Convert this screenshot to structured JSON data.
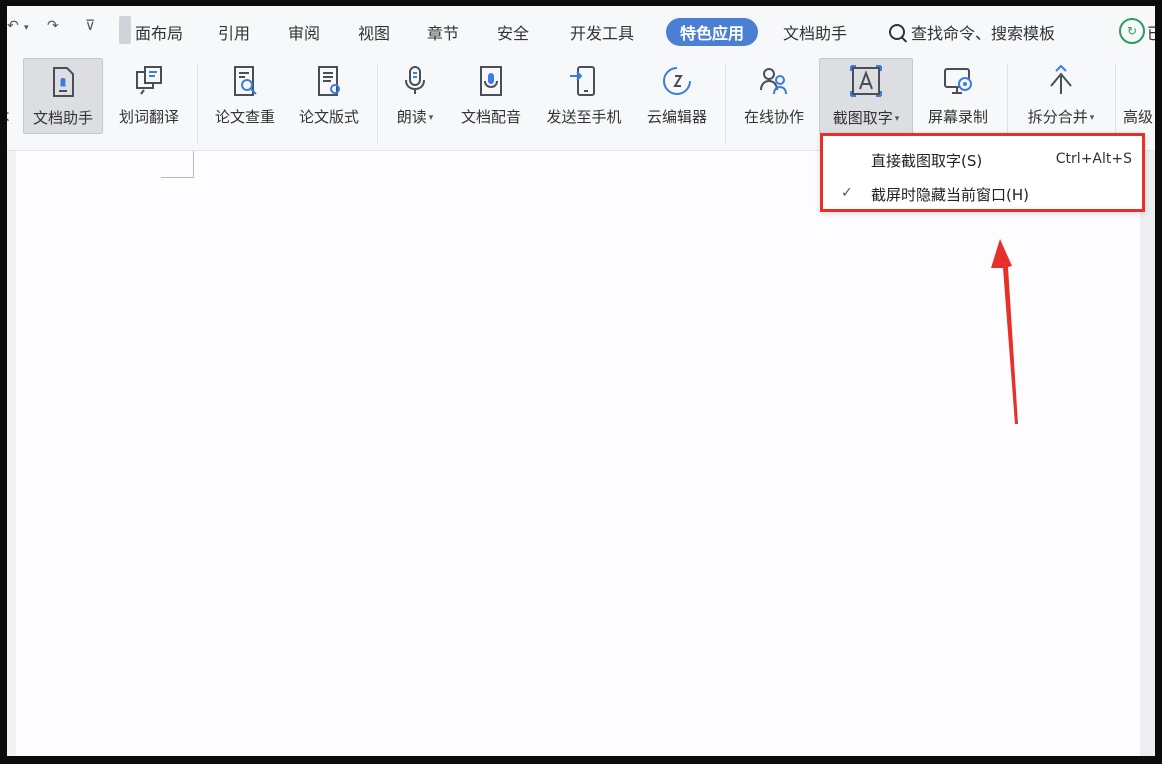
{
  "quick_access": {
    "undo": "↶",
    "undo_caret": "▾",
    "redo": "↷",
    "more": "⊽"
  },
  "menu": {
    "tabs": [
      {
        "label": "面布局"
      },
      {
        "label": "引用"
      },
      {
        "label": "审阅"
      },
      {
        "label": "视图"
      },
      {
        "label": "章节"
      },
      {
        "label": "安全"
      },
      {
        "label": "开发工具"
      },
      {
        "label": "特色应用"
      },
      {
        "label": "文档助手"
      }
    ],
    "search_label": "查找命令、搜索模板",
    "cloud_label": "已"
  },
  "toolbar": {
    "items": [
      {
        "label": "本"
      },
      {
        "label": "文档助手"
      },
      {
        "label": "划词翻译"
      },
      {
        "label": "论文查重"
      },
      {
        "label": "论文版式"
      },
      {
        "label": "朗读"
      },
      {
        "label": "文档配音"
      },
      {
        "label": "发送至手机"
      },
      {
        "label": "云编辑器"
      },
      {
        "label": "在线协作"
      },
      {
        "label": "截图取字"
      },
      {
        "label": "屏幕录制"
      },
      {
        "label": "拆分合并"
      },
      {
        "label": "高级"
      }
    ],
    "caret": "▾"
  },
  "dropdown": {
    "items": [
      {
        "label": "直接截图取字(S)",
        "shortcut": "Ctrl+Alt+S",
        "checked": false
      },
      {
        "label": "截屏时隐藏当前窗口(H)",
        "shortcut": "",
        "checked": true
      }
    ],
    "check_mark": "✓"
  },
  "colors": {
    "accent_tab": "#4a7fd4",
    "highlight_red": "#e8302a",
    "icon_stroke": "#4a4f57",
    "icon_blue": "#3b7de0"
  }
}
